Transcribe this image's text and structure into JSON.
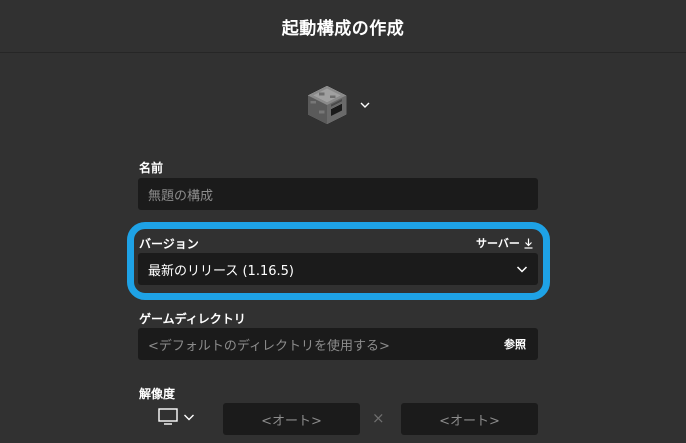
{
  "header": {
    "title": "起動構成の作成"
  },
  "icon_picker": {
    "icon": "furnace-block-icon"
  },
  "name_field": {
    "label": "名前",
    "placeholder": "無題の構成"
  },
  "version_field": {
    "label": "バージョン",
    "server_link": "サーバー",
    "selected": "最新のリリース (1.16.5)"
  },
  "game_dir_field": {
    "label": "ゲームディレクトリ",
    "placeholder": "<デフォルトのディレクトリを使用する>",
    "browse_label": "参照"
  },
  "resolution_field": {
    "label": "解像度",
    "width_placeholder": "<オート>",
    "height_placeholder": "<オート>",
    "separator": "×"
  },
  "colors": {
    "background": "#313131",
    "input_bg": "#1b1b1b",
    "highlight": "#1ea2e6"
  }
}
